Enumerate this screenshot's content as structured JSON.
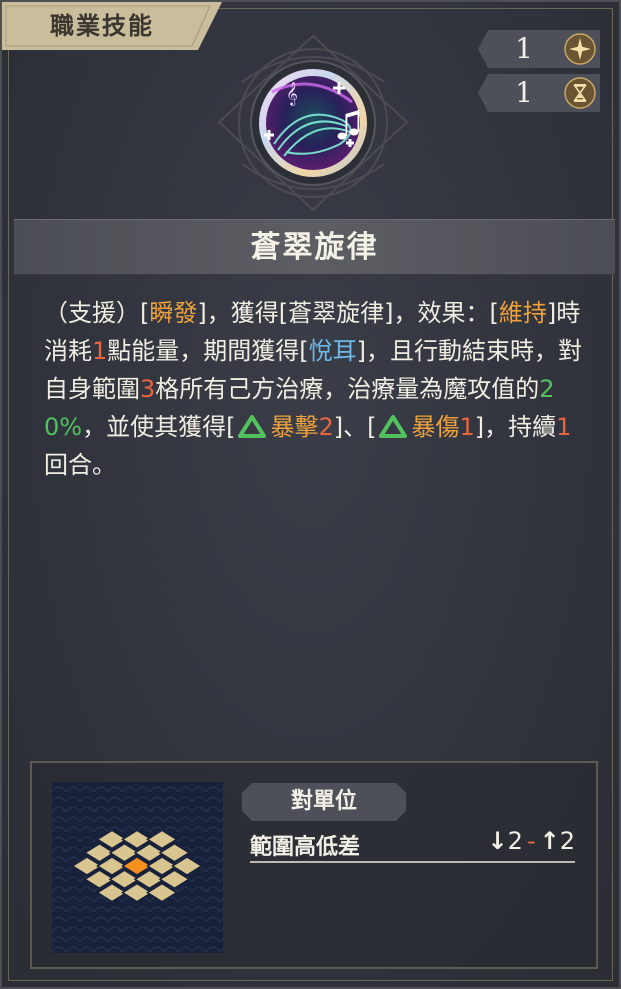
{
  "panel": {
    "tab_title": "職業技能",
    "counters": [
      {
        "value": "1",
        "icon": "sparkle-icon"
      },
      {
        "value": "1",
        "icon": "hourglass-icon"
      }
    ],
    "skill_icon": "music-notes-skill-icon",
    "skill_name": "蒼翠旋律"
  },
  "description": {
    "segments": [
      {
        "text": "（支援）[",
        "style": "normal"
      },
      {
        "text": "瞬發",
        "style": "orange"
      },
      {
        "text": "]，獲得[蒼翠旋律]，效果：[",
        "style": "normal"
      },
      {
        "text": "維持",
        "style": "orange"
      },
      {
        "text": "]時消耗",
        "style": "normal"
      },
      {
        "text": "1",
        "style": "red"
      },
      {
        "text": "點能量，期間獲得[",
        "style": "normal"
      },
      {
        "text": "悅耳",
        "style": "blue"
      },
      {
        "text": "]，且行動結束時，對自身範圍",
        "style": "normal"
      },
      {
        "text": "3",
        "style": "red"
      },
      {
        "text": "格所有己方治療，治療量為魔攻值的",
        "style": "normal"
      },
      {
        "text": "20%",
        "style": "green"
      },
      {
        "text": "，並使其獲得[",
        "style": "normal"
      },
      {
        "text": "",
        "style": "buff-icon"
      },
      {
        "text": "暴擊",
        "style": "orange"
      },
      {
        "text": "2",
        "style": "red"
      },
      {
        "text": "]、[",
        "style": "normal"
      },
      {
        "text": "",
        "style": "buff-icon"
      },
      {
        "text": "暴傷",
        "style": "orange"
      },
      {
        "text": "1",
        "style": "red"
      },
      {
        "text": "]，持續",
        "style": "normal"
      },
      {
        "text": "1",
        "style": "red"
      },
      {
        "text": "回合。",
        "style": "normal"
      }
    ]
  },
  "range_info": {
    "target_type": "對單位",
    "height_label": "範圍高低差",
    "height_down": "2",
    "height_sep": "-",
    "height_up": "2",
    "down_arrow": "↓",
    "up_arrow": "↑"
  },
  "colors": {
    "orange": "#f0a33d",
    "red": "#e8653f",
    "blue": "#6eb8e8",
    "green": "#52c25f",
    "tile": "#d9c590",
    "tile_center": "#f5901e"
  }
}
